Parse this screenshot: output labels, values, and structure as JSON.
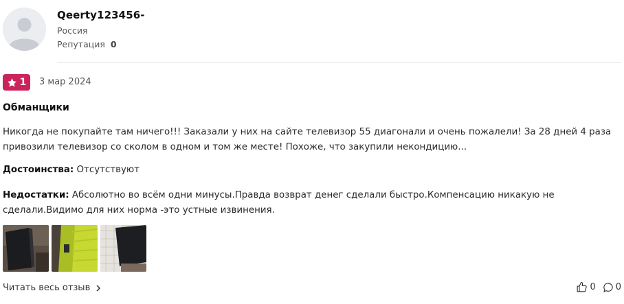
{
  "author": {
    "name": "Qeerty123456-",
    "country": "Россия",
    "reputation_label": "Репутация",
    "reputation_value": "0"
  },
  "review": {
    "rating": "1",
    "date": "3 мар 2024",
    "title": "Обманщики",
    "text": "Никогда не покупайте там ничего!!! Заказали у них на сайте телевизор 55 диагонали и очень пожалели! За 28 дней 4 раза привозили телевизор со сколом в одном и том же месте! Похоже, что закупили некондицию...",
    "pros_label": "Достоинства:",
    "pros_value": "Отсутствуют",
    "cons_label": "Недостатки:",
    "cons_value": "Абсолютно во всём одни минусы.Правда возврат денег сделали быстро.Компенсацию никакую не сделали.Видимо для них норма -это устные извинения.",
    "photos": [
      "photo-1",
      "photo-2",
      "photo-3"
    ],
    "read_more": "Читать весь отзыв",
    "likes": "0",
    "comments": "0"
  },
  "colors": {
    "rating_badge": "#c9245c",
    "divider": "#e6e6e6"
  },
  "icons": {
    "rating": "star-icon",
    "read_more": "chevron-right-icon",
    "like": "thumbs-up-icon",
    "comment": "comment-icon"
  }
}
